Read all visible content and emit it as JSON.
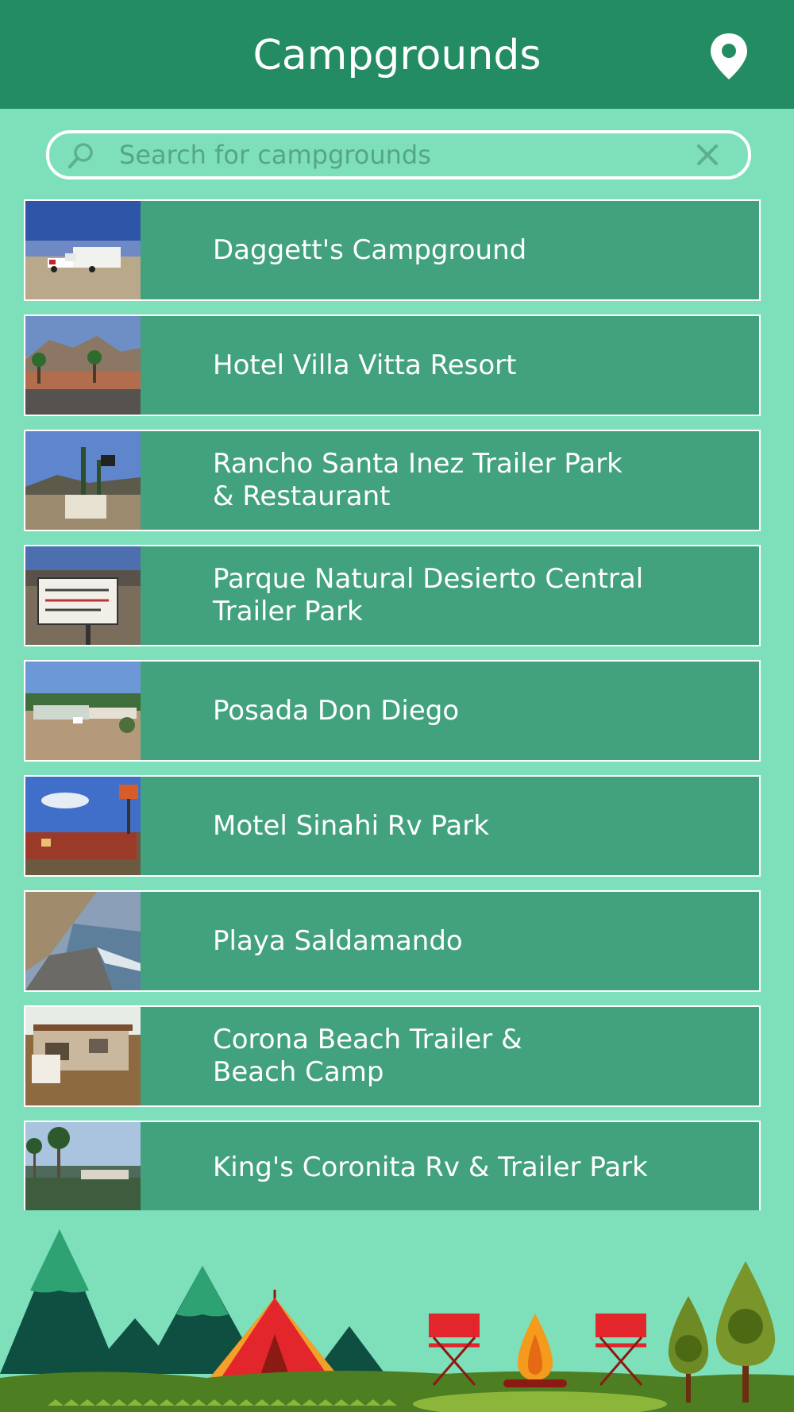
{
  "header": {
    "title": "Campgrounds",
    "location_icon": "map-pin-icon"
  },
  "search": {
    "placeholder": "Search for campgrounds",
    "value": "",
    "search_icon": "search-icon",
    "clear_icon": "clear-icon"
  },
  "campgrounds": [
    {
      "name": "Daggett's Campground"
    },
    {
      "name": "Hotel Villa Vitta Resort"
    },
    {
      "name": "Rancho Santa Inez Trailer Park\n& Restaurant"
    },
    {
      "name": "Parque Natural Desierto Central\nTrailer Park"
    },
    {
      "name": "Posada Don Diego"
    },
    {
      "name": "Motel Sinahi Rv Park"
    },
    {
      "name": "Playa Saldamando"
    },
    {
      "name": "Corona Beach Trailer &\nBeach Camp"
    },
    {
      "name": "King's Coronita Rv & Trailer Park"
    }
  ],
  "colors": {
    "header": "#238c63",
    "background": "#7ee0bb",
    "row": "#42a27d",
    "row_border": "#ffffff"
  }
}
